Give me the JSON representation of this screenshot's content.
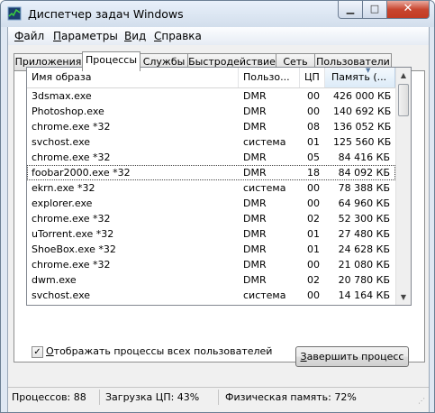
{
  "window": {
    "title": "Диспетчер задач Windows",
    "icon": "task-manager-icon"
  },
  "titlebar_buttons": {
    "minimize": "▁",
    "maximize": "□",
    "close": "✕"
  },
  "menu": [
    {
      "accel": "Ф",
      "rest": "айл"
    },
    {
      "accel": "П",
      "rest": "араметры"
    },
    {
      "accel": "В",
      "rest": "ид"
    },
    {
      "accel": "С",
      "rest": "правка"
    }
  ],
  "tabs": [
    "Приложения",
    "Процессы",
    "Службы",
    "Быстродействие",
    "Сеть",
    "Пользователи"
  ],
  "active_tab": "Процессы",
  "columns": {
    "name": "Имя образа",
    "user": "Пользо...",
    "cpu": "ЦП",
    "memory": "Память (..."
  },
  "sorted_column": "memory",
  "processes": [
    {
      "name": "3dsmax.exe",
      "user": "DMR",
      "cpu": "00",
      "mem": "426 000 КБ"
    },
    {
      "name": "Photoshop.exe",
      "user": "DMR",
      "cpu": "00",
      "mem": "140 692 КБ"
    },
    {
      "name": "chrome.exe *32",
      "user": "DMR",
      "cpu": "08",
      "mem": "136 052 КБ"
    },
    {
      "name": "svchost.exe",
      "user": "система",
      "cpu": "01",
      "mem": "125 560 КБ"
    },
    {
      "name": "chrome.exe *32",
      "user": "DMR",
      "cpu": "05",
      "mem": "84 416 КБ"
    },
    {
      "name": "foobar2000.exe *32",
      "user": "DMR",
      "cpu": "18",
      "mem": "84 092 КБ"
    },
    {
      "name": "ekrn.exe *32",
      "user": "система",
      "cpu": "00",
      "mem": "78 388 КБ"
    },
    {
      "name": "explorer.exe",
      "user": "DMR",
      "cpu": "00",
      "mem": "64 960 КБ"
    },
    {
      "name": "chrome.exe *32",
      "user": "DMR",
      "cpu": "02",
      "mem": "52 300 КБ"
    },
    {
      "name": "uTorrent.exe *32",
      "user": "DMR",
      "cpu": "01",
      "mem": "27 480 КБ"
    },
    {
      "name": "ShoeBox.exe *32",
      "user": "DMR",
      "cpu": "01",
      "mem": "24 628 КБ"
    },
    {
      "name": "chrome.exe *32",
      "user": "DMR",
      "cpu": "00",
      "mem": "21 080 КБ"
    },
    {
      "name": "dwm.exe",
      "user": "DMR",
      "cpu": "02",
      "mem": "20 780 КБ"
    },
    {
      "name": "svchost.exe",
      "user": "система",
      "cpu": "00",
      "mem": "14 164 КБ"
    }
  ],
  "selected_index": 5,
  "show_all_users": {
    "label": "Отображать процессы всех пользователей",
    "accel": "О",
    "checked": true
  },
  "end_process_button": {
    "accel": "З",
    "rest": "авершить процесс"
  },
  "status": {
    "processes": "Процессов: 88",
    "cpu": "Загрузка ЦП: 43%",
    "memory": "Физическая память: 72%"
  }
}
